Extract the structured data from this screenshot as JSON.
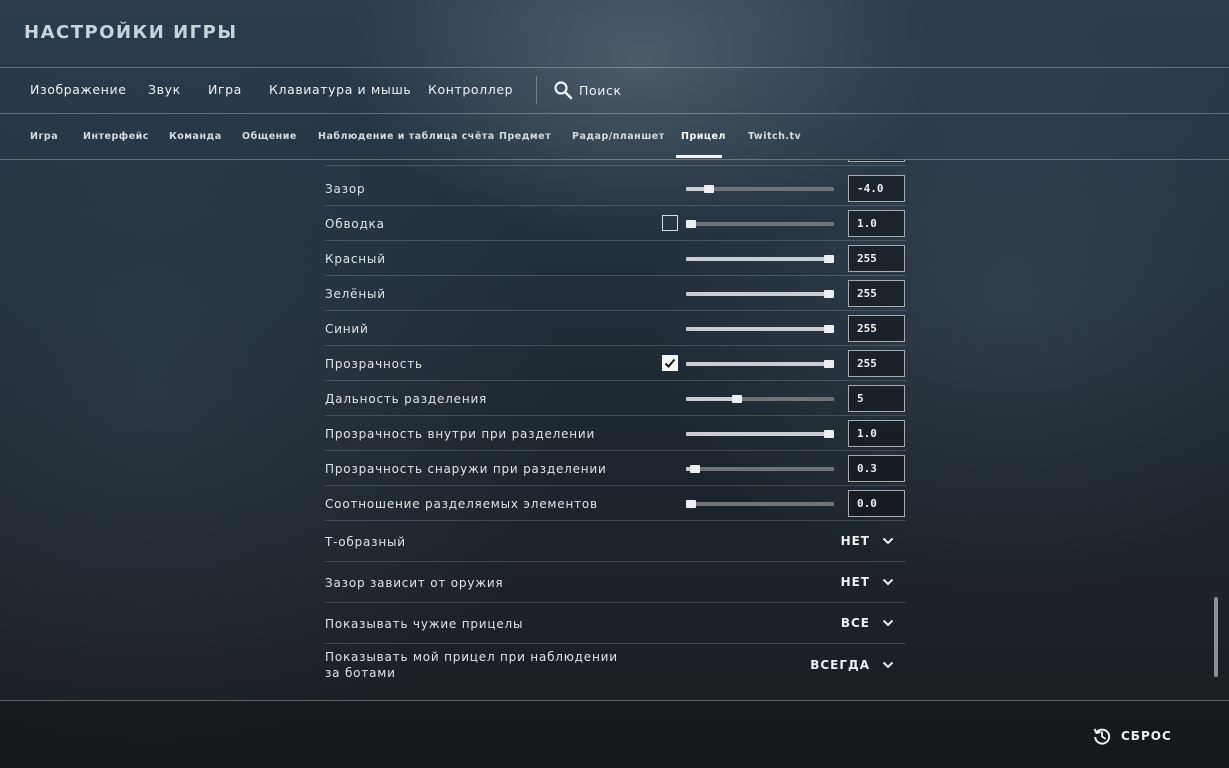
{
  "header": {
    "title": "НАСТРОЙКИ ИГРЫ"
  },
  "main_nav": {
    "items": [
      "Изображение",
      "Звук",
      "Игра",
      "Клавиатура и мышь",
      "Контроллер"
    ],
    "search_label": "Поиск"
  },
  "sub_nav": {
    "items": [
      "Игра",
      "Интерфейс",
      "Команда",
      "Общение",
      "Наблюдение и таблица счёта",
      "Предмет",
      "Радар/планшет",
      "Прицел",
      "Twitch.tv"
    ],
    "active": "Прицел"
  },
  "settings": [
    {
      "label": "Зазор",
      "value": "-4.0",
      "slider_fraction": 0.13,
      "checkbox": null
    },
    {
      "label": "Обводка",
      "value": "1.0",
      "slider_fraction": 0.0,
      "checkbox": false
    },
    {
      "label": "Красный",
      "value": "255",
      "slider_fraction": 1.0,
      "checkbox": null
    },
    {
      "label": "Зелёный",
      "value": "255",
      "slider_fraction": 1.0,
      "checkbox": null
    },
    {
      "label": "Синий",
      "value": "255",
      "slider_fraction": 1.0,
      "checkbox": null
    },
    {
      "label": "Прозрачность",
      "value": "255",
      "slider_fraction": 1.0,
      "checkbox": true
    },
    {
      "label": "Дальность разделения",
      "value": "5",
      "slider_fraction": 0.33,
      "checkbox": null
    },
    {
      "label": "Прозрачность внутри при разделении",
      "value": "1.0",
      "slider_fraction": 1.0,
      "checkbox": null
    },
    {
      "label": "Прозрачность снаружи при разделении",
      "value": "0.3",
      "slider_fraction": 0.03,
      "checkbox": null
    },
    {
      "label": "Соотношение разделяемых элементов",
      "value": "0.0",
      "slider_fraction": 0.0,
      "checkbox": null
    }
  ],
  "dropdowns": [
    {
      "label": "Т-образный",
      "value": "НЕТ"
    },
    {
      "label": "Зазор зависит от оружия",
      "value": "НЕТ"
    },
    {
      "label": "Показывать чужие прицелы",
      "value": "ВСЕ"
    },
    {
      "label_line1": "Показывать мой прицел при наблюдении",
      "label_line2": "за ботами",
      "value": "ВСЕГДА"
    }
  ],
  "footer": {
    "reset_label": "СБРОС"
  },
  "colors": {
    "accent": "#f2f4f6",
    "track": "#6f7377",
    "fill": "#c9cdd1"
  },
  "icons": {
    "search": "search-icon",
    "reset": "reset-history-icon",
    "dropdown": "chevron-down-icon",
    "check": "checkmark-icon"
  }
}
